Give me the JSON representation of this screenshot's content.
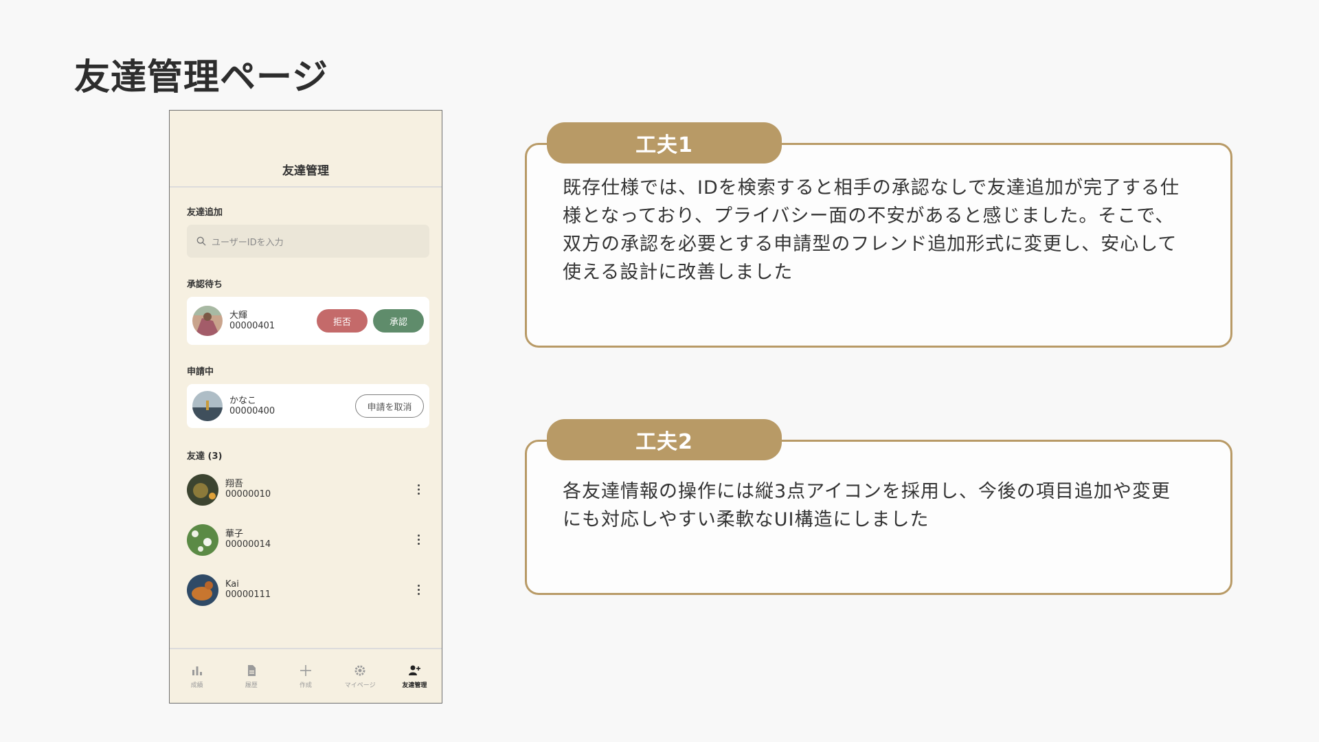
{
  "slide": {
    "title": "友達管理ページ"
  },
  "phone": {
    "header_title": "友達管理",
    "add_friend": {
      "label": "友達追加",
      "search_placeholder": "ユーザーIDを入力"
    },
    "pending": {
      "label": "承認待ち",
      "name": "大輝",
      "id": "00000401",
      "reject_label": "拒否",
      "approve_label": "承認"
    },
    "requesting": {
      "label": "申請中",
      "name": "かなこ",
      "id": "00000400",
      "cancel_label": "申請を取消"
    },
    "friends": {
      "label": "友達 (3)",
      "items": [
        {
          "name": "翔吾",
          "id": "00000010"
        },
        {
          "name": "華子",
          "id": "00000014"
        },
        {
          "name": "Kai",
          "id": "00000111"
        }
      ]
    },
    "tabs": [
      {
        "label": "成績",
        "icon": "bar-chart-icon"
      },
      {
        "label": "履歴",
        "icon": "document-icon"
      },
      {
        "label": "作成",
        "icon": "plus-icon"
      },
      {
        "label": "マイページ",
        "icon": "gear-icon"
      },
      {
        "label": "友達管理",
        "icon": "person-add-icon",
        "active": true
      }
    ]
  },
  "callouts": [
    {
      "title": "工夫1",
      "text": "既存仕様では、IDを検索すると相手の承認なしで友達追加が完了する仕様となっており、プライバシー面の不安があると感じました。そこで、双方の承認を必要とする申請型のフレンド追加形式に変更し、安心して使える設計に改善しました"
    },
    {
      "title": "工夫2",
      "text": "各友達情報の操作には縦3点アイコンを採用し、今後の項目追加や変更にも対応しやすい柔軟なUI構造にしました"
    }
  ],
  "colors": {
    "accent": "#b89a66",
    "phone_bg": "#f6f0e1",
    "reject": "#c46a6a",
    "approve": "#5f8c6b"
  }
}
